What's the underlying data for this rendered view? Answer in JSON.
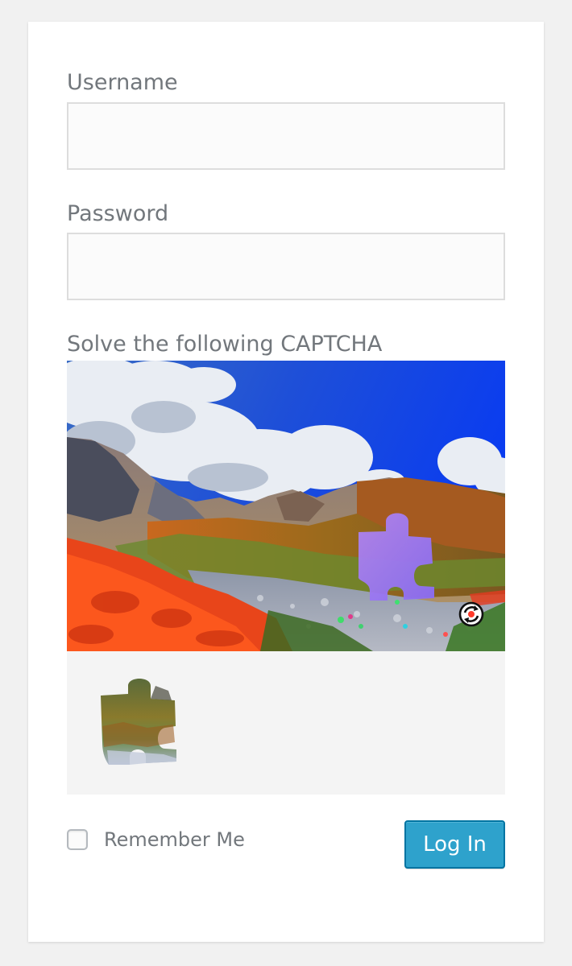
{
  "form": {
    "username_label": "Username",
    "username_value": "",
    "password_label": "Password",
    "password_value": "",
    "captcha_label": "Solve the following CAPTCHA",
    "remember_label": "Remember Me",
    "remember_checked": false,
    "submit_label": "Log In"
  },
  "captcha": {
    "image_icon": "mountain-landscape-image",
    "target_highlight_color": "#a87bf5",
    "refresh_icon": "refresh-icon",
    "piece_icon": "puzzle-piece-icon"
  },
  "colors": {
    "page_background": "#f1f1f1",
    "card_background": "#ffffff",
    "label_text": "#72777c",
    "button_background": "#2ea2cc",
    "button_border": "#0074a2",
    "tray_background": "#f4f4f4"
  }
}
